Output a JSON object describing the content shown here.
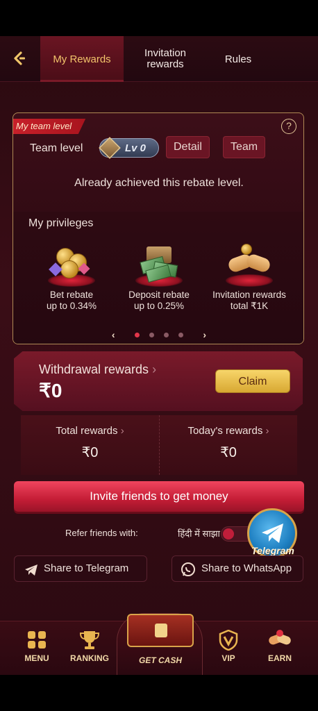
{
  "header": {
    "tabs": [
      {
        "label": "My Rewards",
        "active": true
      },
      {
        "label": "Invitation rewards",
        "active": false
      },
      {
        "label": "Rules",
        "active": false
      }
    ]
  },
  "team_card": {
    "ribbon": "My team level",
    "team_level_label": "Team level",
    "level_badge": "Lv 0",
    "detail_button": "Detail",
    "team_button": "Team",
    "status": "Already achieved this rebate level."
  },
  "privileges": {
    "title": "My privileges",
    "items": [
      {
        "line1": "Bet rebate",
        "line2": "up to 0.34%",
        "icon": "coins-gems-icon"
      },
      {
        "line1": "Deposit rebate",
        "line2": "up to 0.25%",
        "icon": "cash-chest-icon"
      },
      {
        "line1": "Invitation rewards",
        "line2": "total ₹1K",
        "icon": "handshake-icon"
      }
    ],
    "page_active": 1,
    "page_count": 4
  },
  "withdrawal": {
    "title": "Withdrawal rewards",
    "chevron": "›",
    "amount": "₹0",
    "claim_label": "Claim"
  },
  "totals": {
    "total_label": "Total rewards",
    "total_value": "₹0",
    "today_label": "Today's rewards",
    "today_value": "₹0",
    "chevron": "›"
  },
  "invite_button": "Invite friends to get money",
  "refer": {
    "label": "Refer friends with:",
    "language": "हिंदी में साझा करें"
  },
  "telegram_float": "Telegram",
  "share": {
    "telegram": "Share to Telegram",
    "whatsapp": "Share to WhatsApp"
  },
  "nav": {
    "menu": "MENU",
    "ranking": "RANKING",
    "get_cash": "GET CASH",
    "vip": "VIP",
    "earn": "EARN"
  },
  "colors": {
    "accent_red": "#c41d36",
    "gold": "#f2c46b",
    "background": "#2a0a10"
  }
}
